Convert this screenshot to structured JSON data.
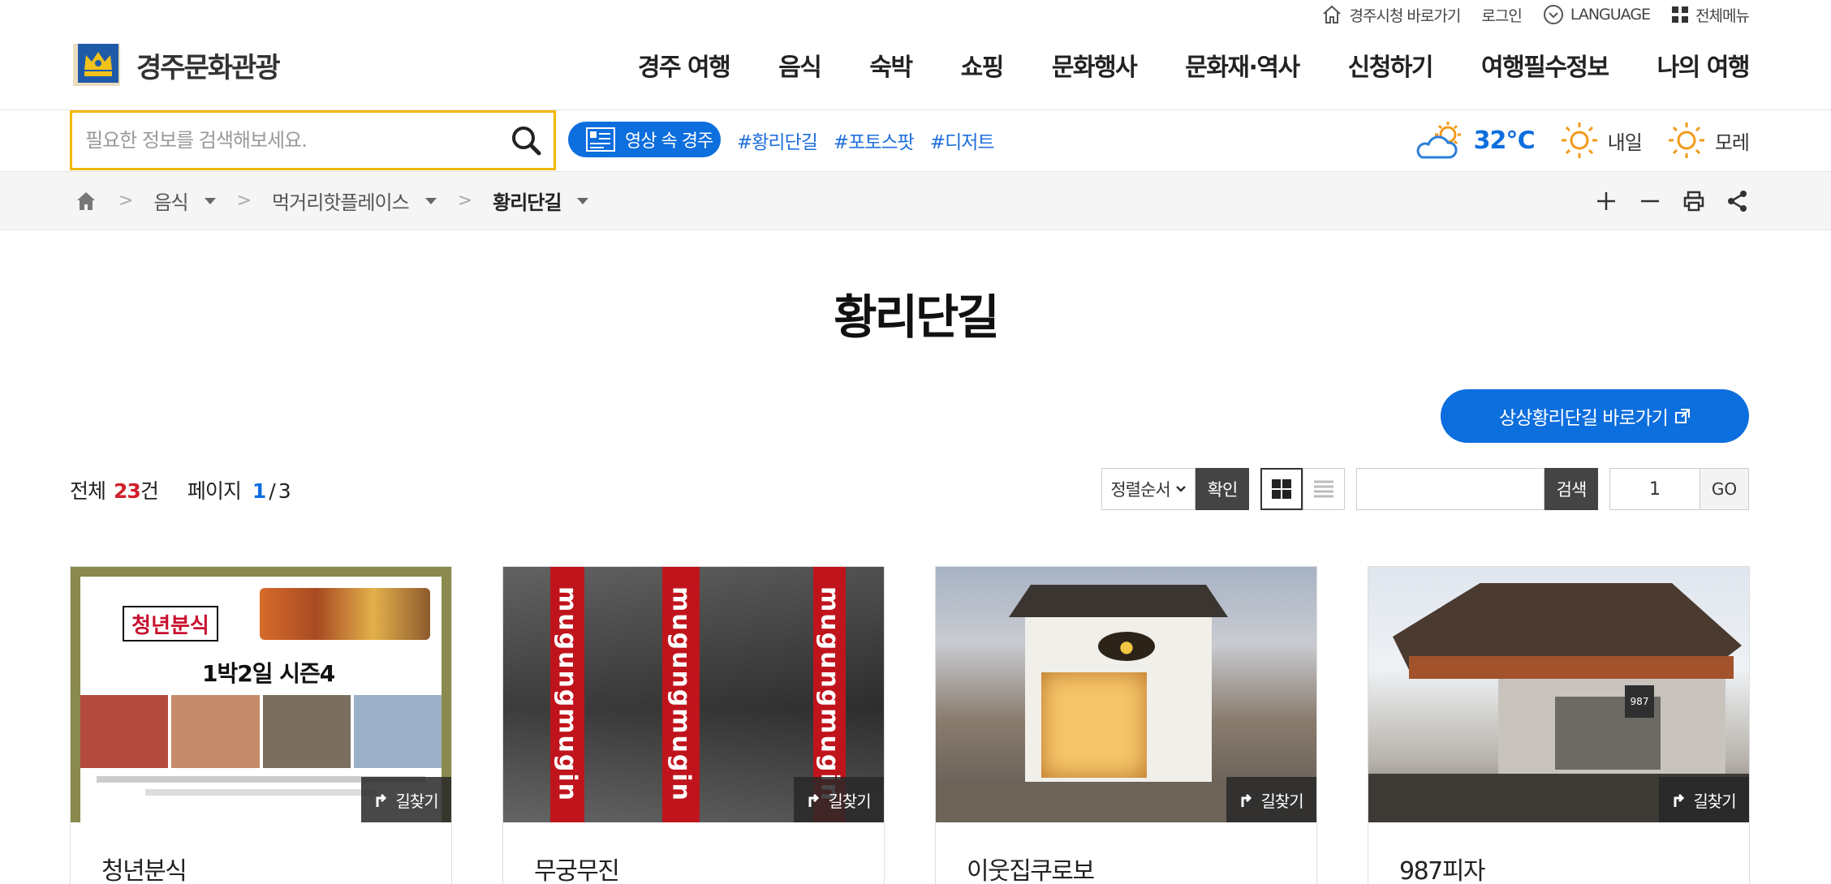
{
  "utility": {
    "city_hall": "경주시청 바로가기",
    "login": "로그인",
    "language": "LANGUAGE",
    "all_menu": "전체메뉴"
  },
  "logo": {
    "text": "경주문화관광"
  },
  "gnb": [
    "경주 여행",
    "음식",
    "숙박",
    "쇼핑",
    "문화행사",
    "문화재·역사",
    "신청하기",
    "여행필수정보",
    "나의 여행"
  ],
  "search": {
    "placeholder": "필요한 정보를 검색해보세요."
  },
  "video_button": "영상 속 경주",
  "hashtags": [
    "#황리단길",
    "#포토스팟",
    "#디저트"
  ],
  "weather": {
    "today_temp": "32℃",
    "tomorrow": "내일",
    "day_after": "모레",
    "colors": {
      "cloud": "#2b7fd8",
      "sun": "#f29a1a"
    }
  },
  "breadcrumb": {
    "items": [
      "음식",
      "먹거리핫플레이스",
      "황리단길"
    ],
    "separator": ">"
  },
  "page": {
    "title": "황리단길",
    "shortcut_button": "상상황리단길 바로가기"
  },
  "list_info": {
    "total_label": "전체",
    "total_count": "23",
    "total_unit": "건",
    "page_label": "페이지",
    "current_page": "1",
    "page_sep": "/",
    "total_pages": "3"
  },
  "controls": {
    "sort_label": "정렬순서",
    "confirm": "확인",
    "search": "검색",
    "page_value": "1",
    "go": "GO"
  },
  "cards": [
    {
      "name": "청년분식",
      "route": "길찾기",
      "poster_brand": "청년분식",
      "poster_title": "1박2일 시즌4"
    },
    {
      "name": "무궁무진",
      "route": "길찾기",
      "pillar_text": "mugungmugin"
    },
    {
      "name": "이웃집쿠로보",
      "route": "길찾기"
    },
    {
      "name": "987피자",
      "route": "길찾기",
      "sign": "987"
    }
  ],
  "colors": {
    "accent_blue": "#0d6ede",
    "search_border": "#f2b705",
    "count_red": "#d0202b"
  }
}
